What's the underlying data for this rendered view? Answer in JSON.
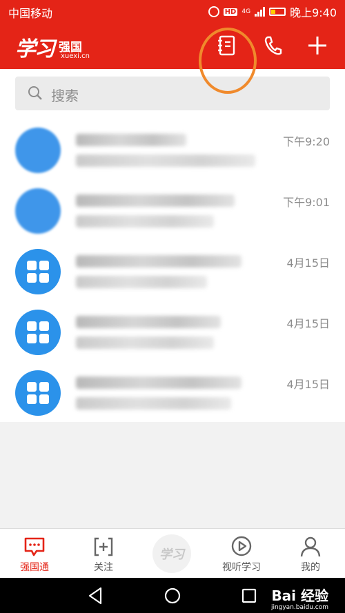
{
  "status_bar": {
    "carrier": "中国移动",
    "time": "晚上9:40",
    "network": "4G",
    "hd": "HD"
  },
  "header": {
    "logo_script": "学习",
    "logo_name": "强国",
    "logo_domain": "xuexi.cn"
  },
  "search": {
    "placeholder": "搜索"
  },
  "conversations": [
    {
      "time": "下午9:20",
      "avatar": "blurred-photo"
    },
    {
      "time": "下午9:01",
      "avatar": "blurred-photo"
    },
    {
      "time": "4月15日",
      "avatar": "app-grid-icon"
    },
    {
      "time": "4月15日",
      "avatar": "app-grid-icon"
    },
    {
      "time": "4月15日",
      "avatar": "app-grid-icon"
    }
  ],
  "bottom_nav": [
    {
      "label": "强国通",
      "icon": "chat-icon",
      "active": true
    },
    {
      "label": "关注",
      "icon": "add-follow-icon",
      "active": false
    },
    {
      "label": "",
      "icon": "xuexi-logo",
      "active": false
    },
    {
      "label": "视听学习",
      "icon": "play-icon",
      "active": false
    },
    {
      "label": "我的",
      "icon": "profile-icon",
      "active": false
    }
  ],
  "bottom_center_logo": "学习",
  "watermark": {
    "brand": "Bai 经验",
    "url": "jingyan.baidu.com"
  },
  "colors": {
    "brand_red": "#e42417",
    "annotation_orange": "#f08a2c",
    "avatar_blue": "#2b92ea"
  }
}
